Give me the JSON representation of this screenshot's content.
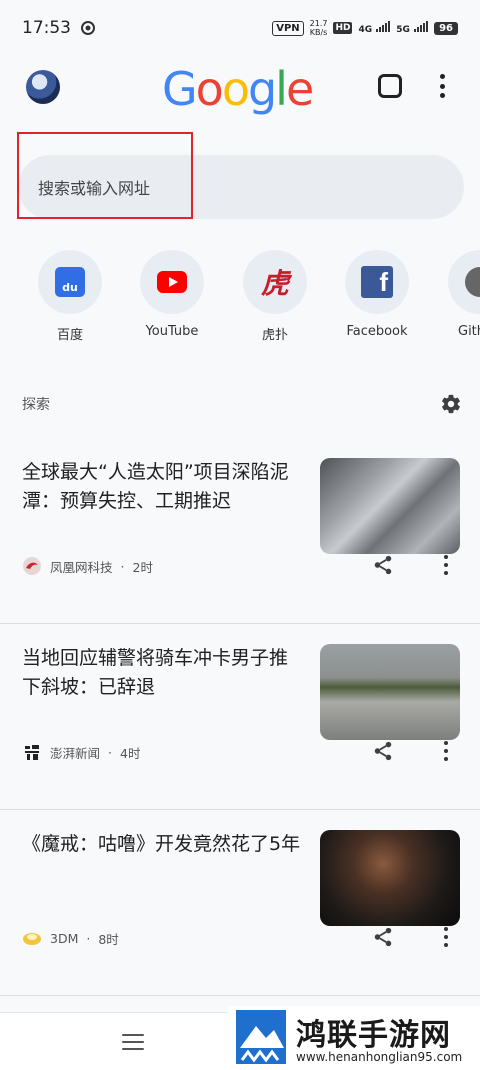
{
  "status_bar": {
    "time": "17:53",
    "vpn": "VPN",
    "speed_value": "21.7",
    "speed_unit": "KB/s",
    "hd": "HD",
    "net1": "4G",
    "net2": "5G",
    "battery": "96"
  },
  "header": {
    "logo_letters": [
      "G",
      "o",
      "o",
      "g",
      "l",
      "e"
    ],
    "logo_colors": [
      "#4285F4",
      "#EA4335",
      "#FBBC05",
      "#4285F4",
      "#34A853",
      "#EA4335"
    ]
  },
  "search": {
    "placeholder": "搜索或输入网址"
  },
  "shortcuts": [
    {
      "label": "百度",
      "icon": "baidu-icon"
    },
    {
      "label": "YouTube",
      "icon": "youtube-icon"
    },
    {
      "label": "虎扑",
      "icon": "hupu-icon"
    },
    {
      "label": "Facebook",
      "icon": "facebook-icon"
    },
    {
      "label": "Gith",
      "icon": "github-icon"
    }
  ],
  "shortcut_glyphs": {
    "baidu": "du",
    "hupu": "虎",
    "facebook": "f"
  },
  "discover": {
    "label": "探索"
  },
  "feed": [
    {
      "title": "全球最大“人造太阳”项目深陷泥潭：预算失控、工期推迟",
      "source": "凤凰网科技",
      "time": "2时"
    },
    {
      "title": "当地回应辅警将骑车冲卡男子推下斜坡：已辞退",
      "source": "澎湃新闻",
      "time": "4时"
    },
    {
      "title": "《魔戒：咕噜》开发竟然花了5年",
      "source": "3DM",
      "time": "8时"
    }
  ],
  "meta_separator": "·",
  "watermark": {
    "title": "鸿联手游网",
    "url": "www.henanhonglian95.com"
  },
  "colors": {
    "highlight": "#e0242a",
    "background": "#f8f9fb"
  }
}
